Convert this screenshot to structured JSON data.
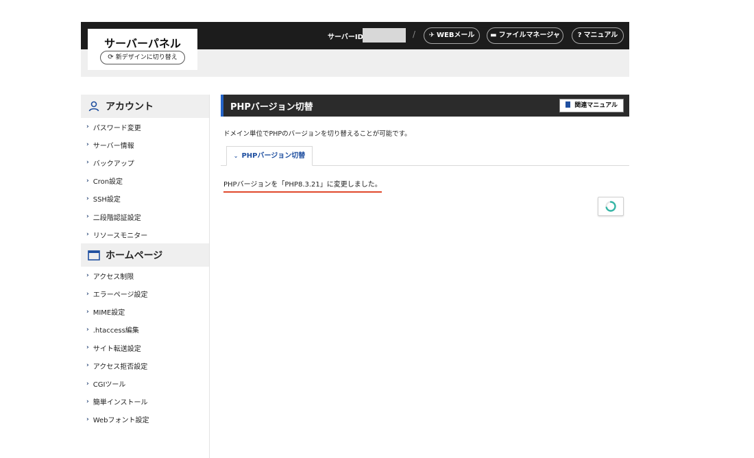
{
  "header": {
    "logo_title": "サーバーパネル",
    "new_design_label": "新デザインに切り替え",
    "server_id_label": "サーバーID :",
    "separator": "/",
    "buttons": [
      {
        "label": "WEBメール",
        "icon": "paper-plane-icon"
      },
      {
        "label": "ファイルマネージャ",
        "icon": "folder-icon"
      },
      {
        "label": "マニュアル",
        "icon": "question-circle-icon"
      }
    ]
  },
  "sidebar": {
    "sections": [
      {
        "title": "アカウント",
        "icon": "user-icon",
        "items": [
          "パスワード変更",
          "サーバー情報",
          "バックアップ",
          "Cron設定",
          "SSH設定",
          "二段階認証設定",
          "リソースモニター"
        ]
      },
      {
        "title": "ホームページ",
        "icon": "browser-window-icon",
        "items": [
          "アクセス制限",
          "エラーページ設定",
          "MIME設定",
          ".htaccess編集",
          "サイト転送設定",
          "アクセス拒否設定",
          "CGIツール",
          "簡単インストール",
          "Webフォント設定"
        ]
      }
    ]
  },
  "main": {
    "title": "PHPバージョン切替",
    "manual_label": "関連マニュアル",
    "description": "ドメイン単位でPHPのバージョンを切り替えることが可能です。",
    "tab_label": "PHPバージョン切替",
    "message": "PHPバージョンを「PHP8.3.21」に変更しました。"
  },
  "colors": {
    "accent_blue": "#1f4fa0",
    "underline_red": "#e0472a",
    "header_dark": "#1c1c1c"
  }
}
